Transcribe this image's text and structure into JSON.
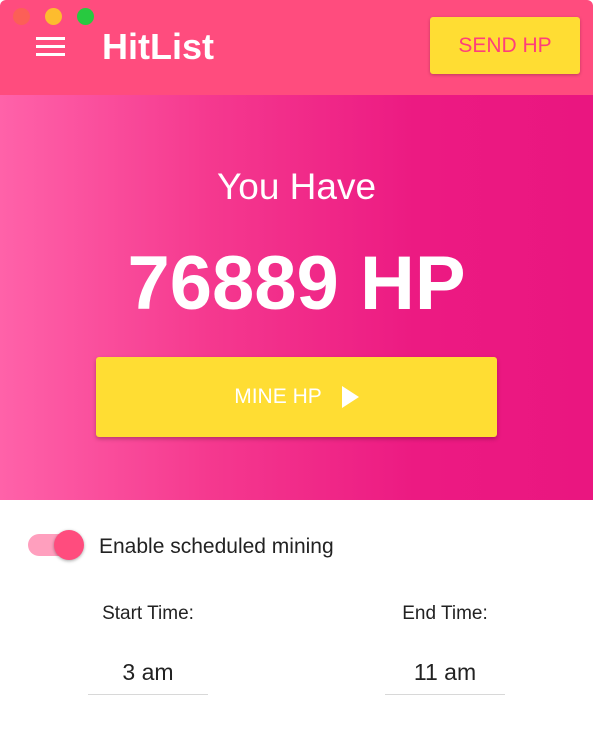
{
  "window": {
    "controls": [
      "close",
      "minimize",
      "maximize"
    ]
  },
  "header": {
    "menu_icon": "hamburger-menu-icon",
    "app_title": "HitList",
    "send_button_label": "SEND HP"
  },
  "balance": {
    "caption": "You Have",
    "amount": "76889 HP"
  },
  "mine_button": {
    "label": "MINE HP",
    "icon": "play-icon"
  },
  "schedule": {
    "enabled": true,
    "toggle_label": "Enable scheduled mining",
    "start_label": "Start Time:",
    "start_value": "3 am",
    "end_label": "End Time:",
    "end_value": "11 am"
  },
  "colors": {
    "primary": "#ff4c7e",
    "accent": "#ffdd33",
    "hero_gradient_start": "#ff62a9",
    "hero_gradient_end": "#ea1680",
    "text_dark": "#222222"
  }
}
